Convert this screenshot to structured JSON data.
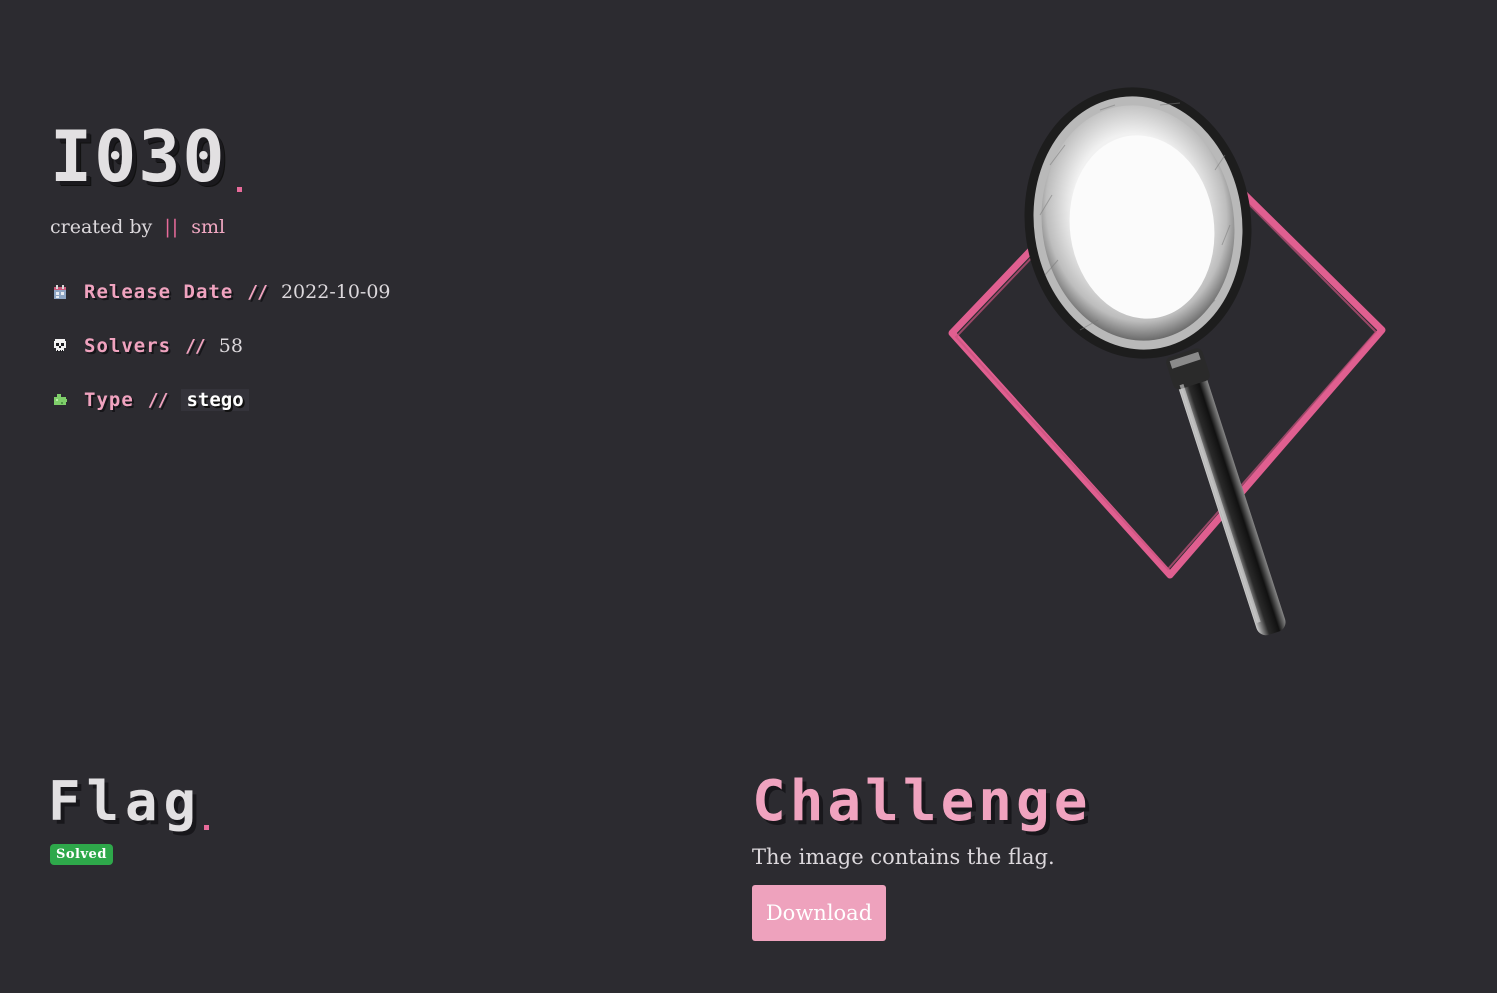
{
  "challenge": {
    "name": "I030",
    "created_prefix": "created by",
    "created_separator": "||",
    "author": "sml"
  },
  "meta": {
    "release": {
      "icon": "calendar-icon",
      "label": "Release Date",
      "separator": "//",
      "value": "2022-10-09"
    },
    "solvers": {
      "icon": "skull-icon",
      "label": "Solvers",
      "separator": "//",
      "value": "58"
    },
    "type": {
      "icon": "puzzle-icon",
      "label": "Type",
      "separator": "//",
      "value": "stego"
    }
  },
  "hero": {
    "icon": "magnifying-glass-icon"
  },
  "flag": {
    "title": "Flag",
    "status": "Solved"
  },
  "challenge_section": {
    "title": "Challenge",
    "description": "The image contains the flag.",
    "download_label": "Download"
  },
  "colors": {
    "background": "#2c2b30",
    "accent_pink": "#f0a3bf",
    "diamond_pink": "#e05f90",
    "solved_green": "#2ea84a",
    "button_pink": "#eea2bd"
  }
}
